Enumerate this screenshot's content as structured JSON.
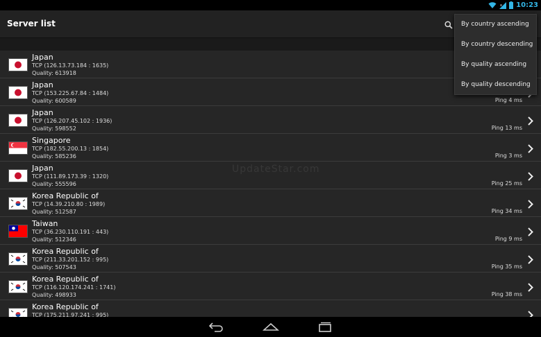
{
  "status": {
    "time": "10:23"
  },
  "actionbar": {
    "title": "Server list"
  },
  "menu": {
    "items": [
      "By country ascending",
      "By country descending",
      "By quality ascending",
      "By quality descending"
    ]
  },
  "watermark": "UpdateStar.com",
  "servers": [
    {
      "country": "Japan",
      "protocol": "TCP (126.13.73.184 : 1635)",
      "quality": "Quality: 613918",
      "ping": "",
      "flag": "japan",
      "chevron": false
    },
    {
      "country": "Japan",
      "protocol": "TCP (153.225.67.84 : 1484)",
      "quality": "Quality: 600589",
      "ping": "Ping 4 ms",
      "flag": "japan",
      "chevron": true
    },
    {
      "country": "Japan",
      "protocol": "TCP (126.207.45.102 : 1936)",
      "quality": "Quality: 598552",
      "ping": "Ping 13 ms",
      "flag": "japan",
      "chevron": true
    },
    {
      "country": "Singapore",
      "protocol": "TCP (182.55.200.13 : 1854)",
      "quality": "Quality: 585236",
      "ping": "Ping 3 ms",
      "flag": "singapore",
      "chevron": true
    },
    {
      "country": "Japan",
      "protocol": "TCP (111.89.173.39 : 1320)",
      "quality": "Quality: 555596",
      "ping": "Ping 25 ms",
      "flag": "japan",
      "chevron": true
    },
    {
      "country": "Korea Republic of",
      "protocol": "TCP (14.39.210.80 : 1989)",
      "quality": "Quality: 512587",
      "ping": "Ping 34 ms",
      "flag": "korea",
      "chevron": true
    },
    {
      "country": "Taiwan",
      "protocol": "TCP (36.230.110.191 : 443)",
      "quality": "Quality: 512346",
      "ping": "Ping 9 ms",
      "flag": "taiwan",
      "chevron": true
    },
    {
      "country": "Korea Republic of",
      "protocol": "TCP (211.33.201.152 : 995)",
      "quality": "Quality: 507543",
      "ping": "Ping 35 ms",
      "flag": "korea",
      "chevron": true
    },
    {
      "country": "Korea Republic of",
      "protocol": "TCP (116.120.174.241 : 1741)",
      "quality": "Quality: 498933",
      "ping": "Ping 38 ms",
      "flag": "korea",
      "chevron": true
    },
    {
      "country": "Korea Republic of",
      "protocol": "TCP (175.211.97.241 : 995)",
      "quality": "",
      "ping": "",
      "flag": "korea",
      "chevron": true
    }
  ],
  "icons": {
    "search": "search-icon",
    "back": "back-icon",
    "home": "home-icon",
    "recents": "recents-icon"
  },
  "colors": {
    "accent": "#33b5e5",
    "background": "#262626",
    "actionbar": "#222222"
  }
}
